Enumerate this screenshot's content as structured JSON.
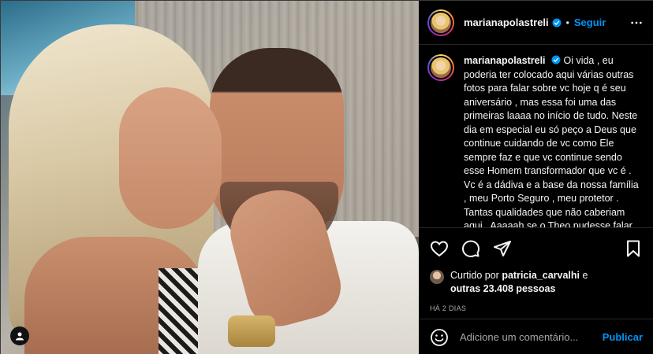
{
  "post": {
    "username": "marianapolastreli",
    "follow_label": "Seguir",
    "separator": "•",
    "caption": "Oi vida , eu poderia ter colocado aqui várias outras fotos para falar sobre vc hoje q é seu aniversário , mas essa foi uma das primeiras laaaa no início de tudo. Neste dia em especial eu só peço a Deus que continue cuidando de vc como Ele sempre faz e que vc continue sendo esse Homem transformador que vc é . Vc é a dádiva e a base da nossa família , meu Porto Seguro , meu protetor . Tantas qualidades que não caberiam aqui . Aaaaah se o Theo pudesse falar como",
    "likes_prefix": "Curtido por",
    "liked_by_user": "patricia_carvalhi",
    "likes_conjunction": "e",
    "likes_others": "outras 23.408 pessoas",
    "time_ago": "HÁ 2 DIAS"
  },
  "comment": {
    "placeholder": "Adicione um comentário...",
    "publish_label": "Publicar"
  },
  "icons": {
    "like": "heart-icon",
    "comment": "comment-icon",
    "share": "share-icon",
    "save": "bookmark-icon",
    "emoji": "emoji-icon",
    "more": "more-icon",
    "tag": "user-tag-icon",
    "verified": "verified-icon"
  },
  "colors": {
    "accent": "#0095f6",
    "background": "#000000",
    "muted": "#a8a8a8"
  }
}
